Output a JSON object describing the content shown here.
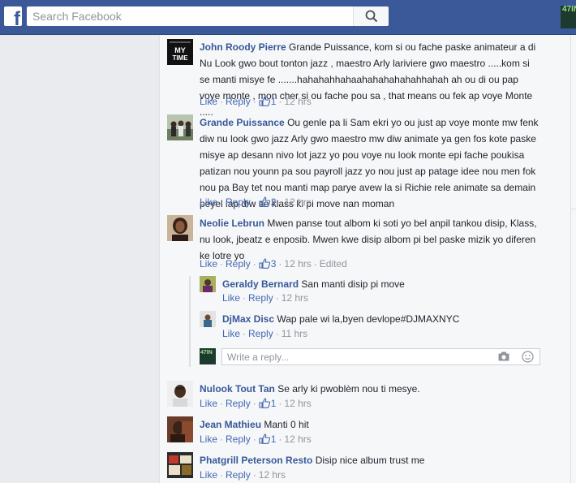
{
  "topbar": {
    "logo": "f",
    "search_placeholder": "Search Facebook",
    "profile_label": "47IN"
  },
  "colors": {
    "brand": "#3b5998",
    "link": "#365899",
    "action": "#4267b2",
    "muted": "#90949c"
  },
  "comments": [
    {
      "author": "John Roody Pierre",
      "text": "Grande Puissance, kom si ou fache paske animateur a di Nu Look gwo bout tonton jazz , maestro Arly lariviere gwo maestro .....kom si se manti misye fe .......hahahahhahaahahahahahahhahah ah ou di ou pap voye monte , mon cher si ou fache pou sa , that means ou fek ap voye Monte .....",
      "like": "Like",
      "reply": "Reply",
      "likes": "1",
      "time": "12 hrs",
      "edited": "",
      "avatar_label": "MY TIME"
    },
    {
      "author": "Grande Puissance",
      "text": "Ou genle pa li Sam ekri yo ou just ap voye monte mw fenk diw nu look gwo jazz Arly gwo maestro mw diw animate ya gen fos kote paske misye ap desann nivo lot jazz yo pou voye nu look monte epi fache poukisa patizan nou younn pa sou payroll jazz yo nou just ap patage idee nou men fok nou pa Bay tet nou manti map parye avew la si Richie rele animate sa demain peyel lap diw se klass ki pi move nan moman",
      "like": "Like",
      "reply": "Reply",
      "likes": "2",
      "time": "12 hrs",
      "edited": ""
    },
    {
      "author": "Neolie Lebrun",
      "text": "Mwen panse tout albom ki soti yo bel anpil tankou disip, Klass, nu look, jbeatz e enposib. Mwen kwe disip albom pi bel paske mizik yo diferen ke lotre yo",
      "like": "Like",
      "reply": "Reply",
      "likes": "3",
      "time": "12 hrs",
      "edited": "Edited"
    },
    {
      "author": "Nulook Tout Tan",
      "text": "Se arly ki pwoblèm nou ti mesye.",
      "like": "Like",
      "reply": "Reply",
      "likes": "1",
      "time": "12 hrs",
      "edited": ""
    },
    {
      "author": "Jean Mathieu",
      "text": "Manti 0 hit",
      "like": "Like",
      "reply": "Reply",
      "likes": "1",
      "time": "12 hrs",
      "edited": ""
    },
    {
      "author": "Phatgrill Peterson Resto",
      "text": "Disip nice album trust me",
      "like": "Like",
      "reply": "Reply",
      "likes": "",
      "time": "12 hrs",
      "edited": ""
    }
  ],
  "replies": [
    {
      "author": "Geraldy Bernard",
      "text": "San manti disip pi move",
      "like": "Like",
      "reply": "Reply",
      "time": "12 hrs"
    },
    {
      "author": "DjMax Disc",
      "text": "Wap pale wi la,byen devlope#DJMAXNYC",
      "like": "Like",
      "reply": "Reply",
      "time": "11 hrs"
    }
  ],
  "reply_box": {
    "placeholder": "Write a reply...",
    "avatar_label": "47IN"
  }
}
